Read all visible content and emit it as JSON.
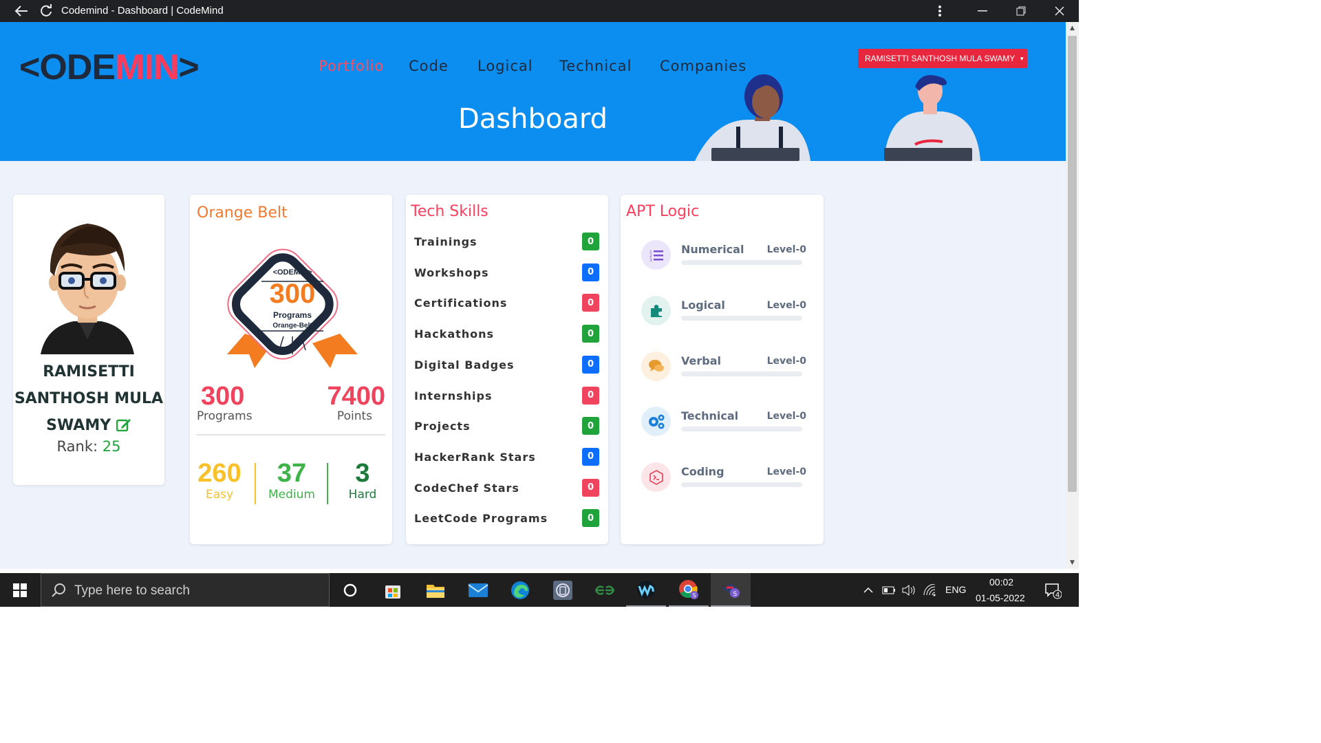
{
  "window": {
    "title": "Codemind - Dashboard | CodeMind"
  },
  "site": {
    "logo_dark_1": "<ODE",
    "logo_red": "MIN",
    "logo_dark_2": ">",
    "nav": [
      {
        "label": "Portfolio",
        "active": true
      },
      {
        "label": "Code",
        "active": false
      },
      {
        "label": "Logical",
        "active": false
      },
      {
        "label": "Technical",
        "active": false
      },
      {
        "label": "Companies",
        "active": false
      }
    ],
    "user_menu": "RAMISETTI SANTHOSH MULA SWAMY",
    "page_title": "Dashboard"
  },
  "profile": {
    "name_line1": "RAMISETTI",
    "name_line2": "SANTHOSH MULA",
    "name_line3": "SWAMY",
    "rank_label": "Rank:",
    "rank_value": "25",
    "edit_icon": "edit-icon"
  },
  "belt": {
    "title": "Orange Belt",
    "badge_logo": "<ODEMIN>",
    "badge_number": "300",
    "badge_line1": "Programs",
    "badge_line2": "Orange-Belt",
    "programs_value": "300",
    "programs_label": "Programs",
    "points_value": "7400",
    "points_label": "Points",
    "easy_value": "260",
    "easy_label": "Easy",
    "medium_value": "37",
    "medium_label": "Medium",
    "hard_value": "3",
    "hard_label": "Hard",
    "colors": {
      "easy": "#f9c02a",
      "medium": "#3db34a",
      "hard": "#1d7a3c"
    }
  },
  "tech_skills": {
    "title": "Tech Skills",
    "items": [
      {
        "label": "Trainings",
        "count": "0",
        "color": "#1fa33a"
      },
      {
        "label": "Workshops",
        "count": "0",
        "color": "#0d6efd"
      },
      {
        "label": "Certifications",
        "count": "0",
        "color": "#f0435e"
      },
      {
        "label": "Hackathons",
        "count": "0",
        "color": "#1fa33a"
      },
      {
        "label": "Digital Badges",
        "count": "0",
        "color": "#0d6efd"
      },
      {
        "label": "Internships",
        "count": "0",
        "color": "#f0435e"
      },
      {
        "label": "Projects",
        "count": "0",
        "color": "#1fa33a"
      },
      {
        "label": "HackerRank Stars",
        "count": "0",
        "color": "#0d6efd"
      },
      {
        "label": "CodeChef Stars",
        "count": "0",
        "color": "#f0435e"
      },
      {
        "label": "LeetCode Programs",
        "count": "0",
        "color": "#1fa33a"
      }
    ]
  },
  "apt_logic": {
    "title": "APT Logic",
    "items": [
      {
        "name": "Numerical",
        "level": "Level-0",
        "icon": "list-numbered-icon",
        "icon_color": "#7b4fd1",
        "icon_bg": "#ece6fa",
        "progress": 0
      },
      {
        "name": "Logical",
        "level": "Level-0",
        "icon": "puzzle-icon",
        "icon_color": "#138a7a",
        "icon_bg": "#e2f2ef",
        "progress": 0
      },
      {
        "name": "Verbal",
        "level": "Level-0",
        "icon": "chat-icon",
        "icon_color": "#e69a2e",
        "icon_bg": "#fdf0de",
        "progress": 0
      },
      {
        "name": "Technical",
        "level": "Level-0",
        "icon": "gears-icon",
        "icon_color": "#1a80d9",
        "icon_bg": "#e1effb",
        "progress": 0
      },
      {
        "name": "Coding",
        "level": "Level-0",
        "icon": "terminal-icon",
        "icon_color": "#e2425a",
        "icon_bg": "#fce5e8",
        "progress": 0
      }
    ]
  },
  "taskbar": {
    "search_placeholder": "Type here to search",
    "language": "ENG",
    "time": "00:02",
    "date": "01-05-2022",
    "notification_count": "4"
  }
}
